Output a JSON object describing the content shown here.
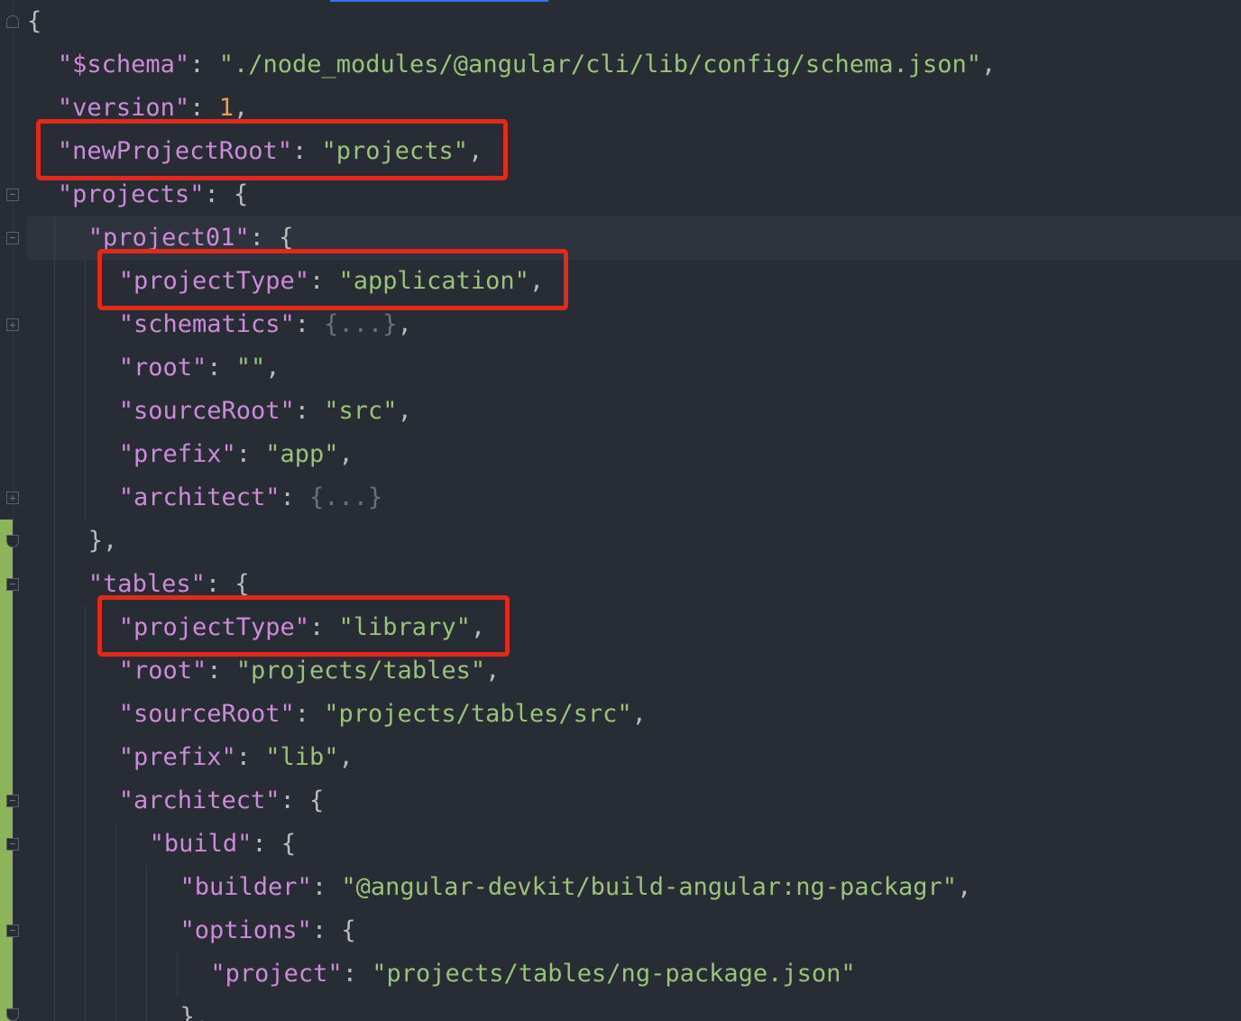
{
  "lines": [
    {
      "indent": 0,
      "key": "",
      "sep": "",
      "value": "",
      "value_type": "",
      "trail": "{"
    },
    {
      "indent": 1,
      "key": "\"$schema\"",
      "sep": ": ",
      "value": "\"./node_modules/@angular/cli/lib/config/schema.json\"",
      "value_type": "string",
      "trail": ","
    },
    {
      "indent": 1,
      "key": "\"version\"",
      "sep": ": ",
      "value": "1",
      "value_type": "number",
      "trail": ","
    },
    {
      "indent": 1,
      "key": "\"newProjectRoot\"",
      "sep": ": ",
      "value": "\"projects\"",
      "value_type": "string",
      "trail": ","
    },
    {
      "indent": 1,
      "key": "\"projects\"",
      "sep": ": ",
      "value": "",
      "value_type": "",
      "trail": "{"
    },
    {
      "indent": 2,
      "key": "\"project01\"",
      "sep": ": ",
      "value": "",
      "value_type": "",
      "trail": "{"
    },
    {
      "indent": 3,
      "key": "\"projectType\"",
      "sep": ": ",
      "value": "\"application\"",
      "value_type": "string",
      "trail": ","
    },
    {
      "indent": 3,
      "key": "\"schematics\"",
      "sep": ": ",
      "value": "{...}",
      "value_type": "collapsed",
      "trail": ","
    },
    {
      "indent": 3,
      "key": "\"root\"",
      "sep": ": ",
      "value": "\"\"",
      "value_type": "string",
      "trail": ","
    },
    {
      "indent": 3,
      "key": "\"sourceRoot\"",
      "sep": ": ",
      "value": "\"src\"",
      "value_type": "string",
      "trail": ","
    },
    {
      "indent": 3,
      "key": "\"prefix\"",
      "sep": ": ",
      "value": "\"app\"",
      "value_type": "string",
      "trail": ","
    },
    {
      "indent": 3,
      "key": "\"architect\"",
      "sep": ": ",
      "value": "{...}",
      "value_type": "collapsed",
      "trail": ""
    },
    {
      "indent": 2,
      "key": "",
      "sep": "",
      "value": "",
      "value_type": "",
      "trail": "},"
    },
    {
      "indent": 2,
      "key": "\"tables\"",
      "sep": ": ",
      "value": "",
      "value_type": "",
      "trail": "{"
    },
    {
      "indent": 3,
      "key": "\"projectType\"",
      "sep": ": ",
      "value": "\"library\"",
      "value_type": "string",
      "trail": ","
    },
    {
      "indent": 3,
      "key": "\"root\"",
      "sep": ": ",
      "value": "\"projects/tables\"",
      "value_type": "string",
      "trail": ","
    },
    {
      "indent": 3,
      "key": "\"sourceRoot\"",
      "sep": ": ",
      "value": "\"projects/tables/src\"",
      "value_type": "string",
      "trail": ","
    },
    {
      "indent": 3,
      "key": "\"prefix\"",
      "sep": ": ",
      "value": "\"lib\"",
      "value_type": "string",
      "trail": ","
    },
    {
      "indent": 3,
      "key": "\"architect\"",
      "sep": ": ",
      "value": "",
      "value_type": "",
      "trail": "{"
    },
    {
      "indent": 4,
      "key": "\"build\"",
      "sep": ": ",
      "value": "",
      "value_type": "",
      "trail": "{"
    },
    {
      "indent": 5,
      "key": "\"builder\"",
      "sep": ": ",
      "value": "\"@angular-devkit/build-angular:ng-packagr\"",
      "value_type": "string",
      "trail": ","
    },
    {
      "indent": 5,
      "key": "\"options\"",
      "sep": ": ",
      "value": "",
      "value_type": "",
      "trail": "{"
    },
    {
      "indent": 6,
      "key": "\"project\"",
      "sep": ": ",
      "value": "\"projects/tables/ng-package.json\"",
      "value_type": "string",
      "trail": ""
    },
    {
      "indent": 5,
      "key": "",
      "sep": "",
      "value": "",
      "value_type": "",
      "trail": "},"
    }
  ],
  "highlighted_lines": [
    3,
    6,
    14
  ],
  "caret_line": 5,
  "colors": {
    "background": "#282c34",
    "key": "#cc8bd9",
    "string": "#98c379",
    "number": "#e0a060",
    "highlight_box": "#e3281c",
    "vcs_added": "#8cb45a"
  }
}
